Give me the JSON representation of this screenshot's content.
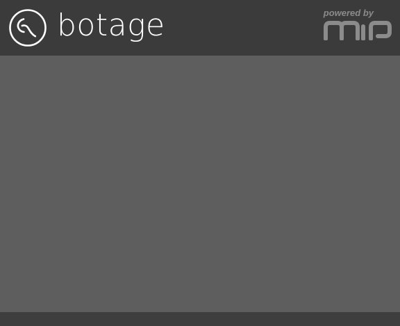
{
  "header": {
    "brand_name": "botage",
    "powered_label": "powered by",
    "powered_logo_text": "MIP"
  },
  "colors": {
    "header_bg": "#3b3b3b",
    "content_bg": "#5e5e5e",
    "footer_bg": "#3e3e3e",
    "brand_text": "#ffffff",
    "powered_text": "#8b8b8b"
  },
  "icons": {
    "brand_mark": "botage-logo-icon",
    "powered_mark": "mip-logo-icon"
  }
}
